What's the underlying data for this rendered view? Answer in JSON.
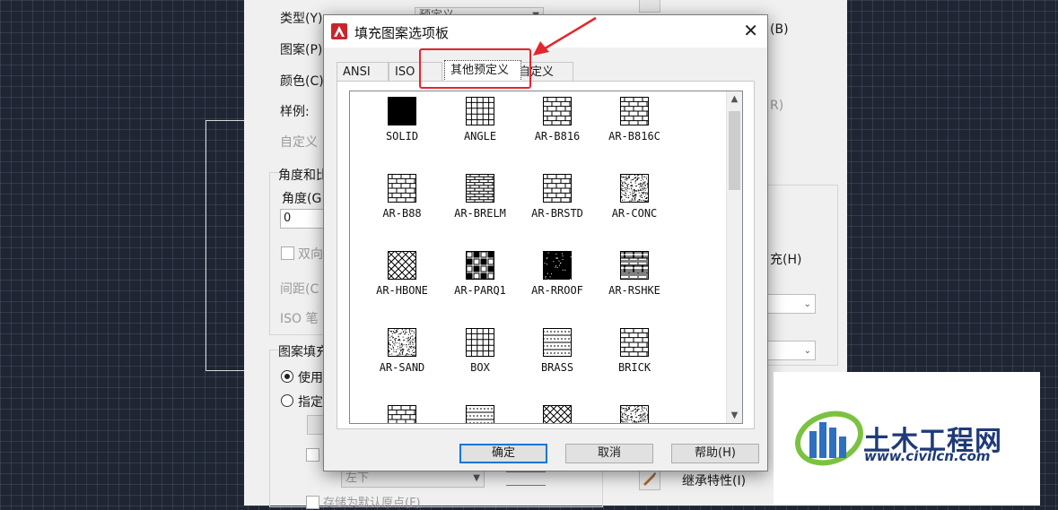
{
  "background_dialog": {
    "type_label": "类型(Y)",
    "type_value": "预定义",
    "pattern_label": "图案(P)",
    "color_label": "颜色(C)",
    "swatch_label": "样例:",
    "custom_label": "自定义",
    "angle_group": "角度和比",
    "angle_label": "角度(G",
    "angle_value": "0",
    "double_label": "双向",
    "spacing_label": "间距(C",
    "iso_label": "ISO 笔",
    "origin_group": "图案填充",
    "use_label": "使用",
    "specify_label": "指定",
    "bottom_left": "左下",
    "store_default": "存储为默认原点(F)",
    "right_r": "(B)",
    "right_r2": "R)",
    "fill_label": "充(H)",
    "inherit_label": "继承特性(I)"
  },
  "dialog": {
    "title": "填充图案选项板",
    "tabs": [
      "ANSI",
      "ISO",
      "其他预定义",
      "自定义"
    ],
    "active_tab": "其他预定义",
    "patterns": [
      "SOLID",
      "ANGLE",
      "AR-B816",
      "AR-B816C",
      "AR-B88",
      "AR-BRELM",
      "AR-BRSTD",
      "AR-CONC",
      "AR-HBONE",
      "AR-PARQ1",
      "AR-RROOF",
      "AR-RSHKE",
      "AR-SAND",
      "BOX",
      "BRASS",
      "BRICK"
    ],
    "buttons": {
      "ok": "确定",
      "cancel": "取消",
      "help": "帮助(H)"
    }
  },
  "watermark": {
    "title": "土木工程网",
    "url": "www.civilcn.com"
  },
  "colors": {
    "accent": "#0078d7",
    "annotation": "#e3262c",
    "brand": "#1f3a78"
  }
}
